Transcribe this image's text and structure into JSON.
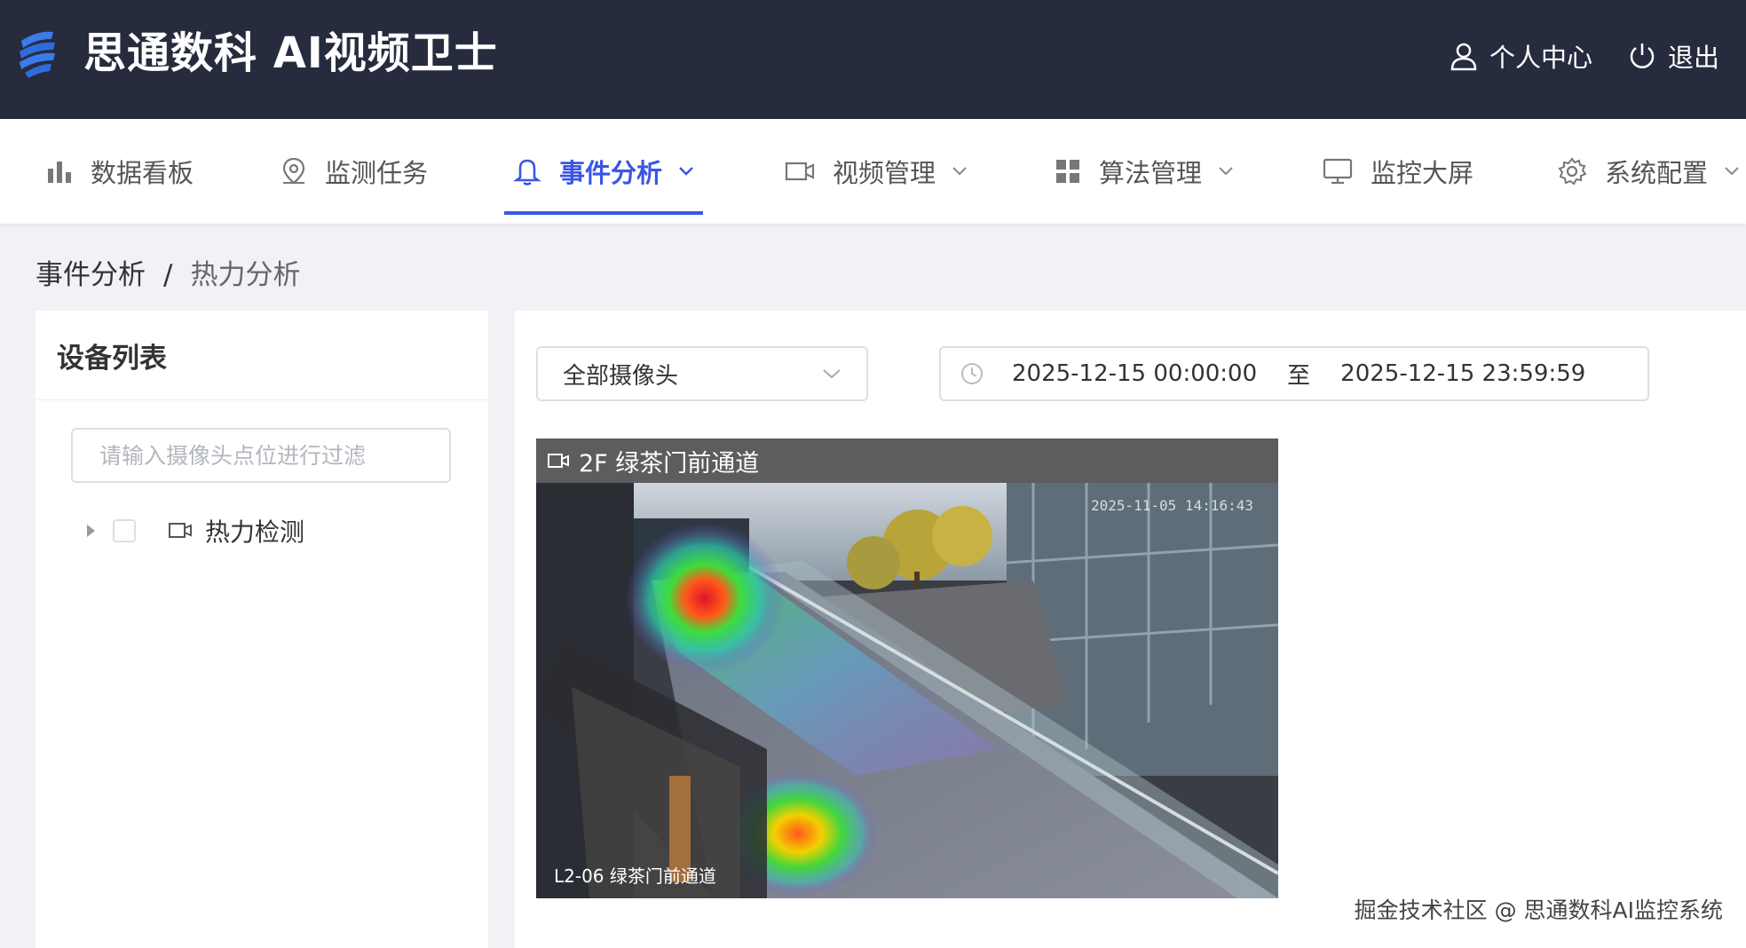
{
  "header": {
    "title": "思通数科 AI视频卫士",
    "user_center": "个人中心",
    "logout": "退出"
  },
  "nav": {
    "items": [
      {
        "label": "数据看板",
        "icon": "bar-chart-icon"
      },
      {
        "label": "监测任务",
        "icon": "location-pin-icon"
      },
      {
        "label": "事件分析",
        "icon": "bell-icon",
        "active": true,
        "dropdown": true
      },
      {
        "label": "视频管理",
        "icon": "video-camera-icon",
        "dropdown": true
      },
      {
        "label": "算法管理",
        "icon": "grid-icon",
        "dropdown": true
      },
      {
        "label": "监控大屏",
        "icon": "monitor-icon"
      },
      {
        "label": "系统配置",
        "icon": "gear-icon",
        "dropdown": true
      }
    ]
  },
  "breadcrumb": {
    "parent": "事件分析",
    "separator": "/",
    "current": "热力分析"
  },
  "left_panel": {
    "title": "设备列表",
    "filter_placeholder": "请输入摄像头点位进行过滤",
    "tree": [
      {
        "label": "热力检测"
      }
    ]
  },
  "filters": {
    "camera_select": "全部摄像头",
    "date_start": "2025-12-15 00:00:00",
    "date_sep": "至",
    "date_end": "2025-12-15 23:59:59"
  },
  "video": {
    "title": "2F 绿茶门前通道",
    "timestamp": "2025-11-05 14:16:43",
    "caption": "L2-06  绿茶门前通道"
  },
  "watermark": "掘金技术社区 @ 思通数科AI监控系统",
  "colors": {
    "header_bg": "#262c3e",
    "accent": "#3b55e6",
    "page_bg": "#f0f2f6"
  }
}
